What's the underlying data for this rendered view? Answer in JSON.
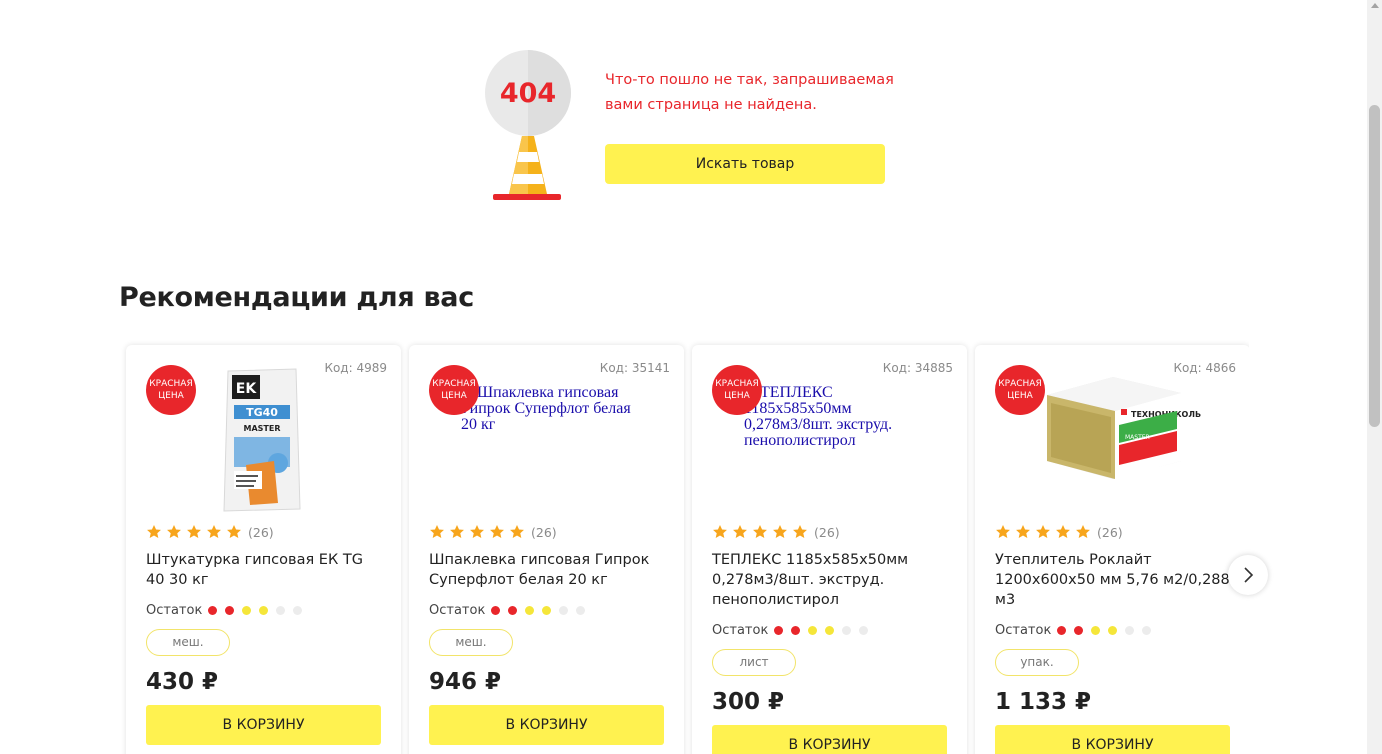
{
  "error": {
    "code_label": "404",
    "message": "Что-то пошло не так, запрашиваемая вами страница не найдена.",
    "search_button": "Искать товар"
  },
  "recommendations": {
    "title": "Рекомендации для вас",
    "stock_label": "Остаток",
    "cart_label": "В КОРЗИНУ",
    "badge_line1": "КРАСНАЯ",
    "badge_line2": "ЦЕНА",
    "products": [
      {
        "code": "Код: 4989",
        "image": "ek-tg40-bag",
        "image_alt": "",
        "rating": 5,
        "reviews": "(26)",
        "name": "Штукатурка гипсовая ЕК TG 40 30 кг",
        "stock_dots": [
          "red",
          "red",
          "yellow",
          "yellow",
          "grey",
          "grey"
        ],
        "unit": "меш.",
        "price": "430 ₽"
      },
      {
        "code": "Код: 35141",
        "image": "broken-image",
        "image_alt": "Шпаклевка гипсовая Гипрок Суперфлот белая 20 кг",
        "rating": 5,
        "reviews": "(26)",
        "name": "Шпаклевка гипсовая Гипрок Суперфлот белая 20 кг",
        "stock_dots": [
          "red",
          "red",
          "yellow",
          "yellow",
          "grey",
          "grey"
        ],
        "unit": "меш.",
        "price": "946 ₽"
      },
      {
        "code": "Код: 34885",
        "image": "broken-image",
        "image_alt": "ТЕПЛЕКС 1185х585х50мм 0,278м3/8шт. экструд. пенополистирол",
        "rating": 5,
        "reviews": "(26)",
        "name": "ТЕПЛЕКС 1185х585х50мм 0,278м3/8шт. экструд. пенополистирол",
        "stock_dots": [
          "red",
          "red",
          "yellow",
          "yellow",
          "grey",
          "grey"
        ],
        "unit": "лист",
        "price": "300 ₽"
      },
      {
        "code": "Код: 4866",
        "image": "technonicol-pack",
        "image_alt": "",
        "rating": 5,
        "reviews": "(26)",
        "name": "Утеплитель Роклайт 1200х600х50 мм 5,76 м2/0,288 м3",
        "stock_dots": [
          "red",
          "red",
          "yellow",
          "yellow",
          "grey",
          "grey"
        ],
        "unit": "упак.",
        "price": "1 133 ₽"
      }
    ]
  },
  "colors": {
    "accent_yellow": "#fff250",
    "brand_red": "#e8262b",
    "star": "#f7a51c"
  },
  "icons": {
    "next": "chevron-right-icon",
    "star": "star-icon"
  }
}
